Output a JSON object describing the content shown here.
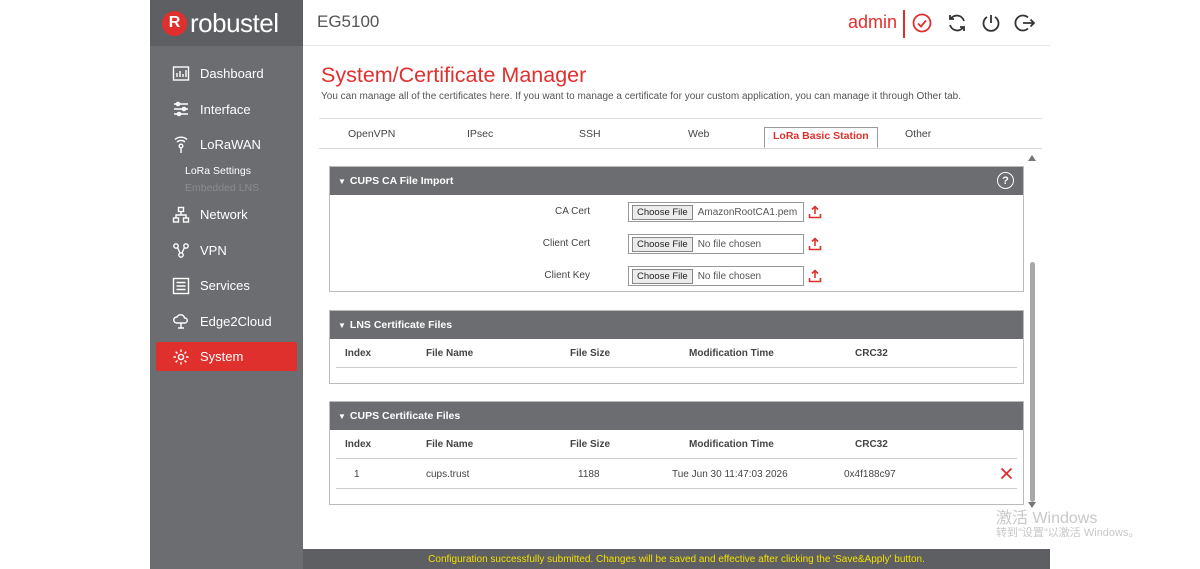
{
  "brand": {
    "logo_mark": "R",
    "name": "robustel"
  },
  "header": {
    "device": "EG5100",
    "user": "admin",
    "icons": [
      "check-circle-icon",
      "refresh-icon",
      "power-refresh-icon",
      "logout-icon"
    ]
  },
  "sidebar": {
    "items": [
      {
        "label": "Dashboard",
        "icon": "dashboard-icon"
      },
      {
        "label": "Interface",
        "icon": "sliders-icon"
      },
      {
        "label": "LoRaWAN",
        "icon": "signal-icon"
      },
      {
        "label": "Network",
        "icon": "network-icon"
      },
      {
        "label": "VPN",
        "icon": "vpn-icon"
      },
      {
        "label": "Services",
        "icon": "list-icon"
      },
      {
        "label": "Edge2Cloud",
        "icon": "cloud-icon"
      },
      {
        "label": "System",
        "icon": "gear-icon"
      }
    ],
    "lorawan_sub": [
      "LoRa Settings",
      "Embedded LNS"
    ],
    "active": "System"
  },
  "page": {
    "title": "System/Certificate Manager",
    "subtitle": "You can manage all of the certificates here. If you want to manage a certificate for your custom application, you can manage it through Other tab."
  },
  "tabs": [
    "OpenVPN",
    "IPsec",
    "SSH",
    "Web",
    "LoRa Basic Station",
    "Other"
  ],
  "active_tab": "LoRa Basic Station",
  "cups_ca": {
    "title": "CUPS CA File Import",
    "help": "?",
    "choose_label": "Choose File",
    "rows": [
      {
        "label": "CA Cert",
        "file": "AmazonRootCA1.pem"
      },
      {
        "label": "Client Cert",
        "file": "No file chosen"
      },
      {
        "label": "Client Key",
        "file": "No file chosen"
      }
    ]
  },
  "lns_files": {
    "title": "LNS Certificate Files",
    "columns": [
      "Index",
      "File Name",
      "File Size",
      "Modification Time",
      "CRC32"
    ],
    "rows": []
  },
  "cups_files": {
    "title": "CUPS Certificate Files",
    "columns": [
      "Index",
      "File Name",
      "File Size",
      "Modification Time",
      "CRC32"
    ],
    "rows": [
      {
        "index": "1",
        "name": "cups.trust",
        "size": "1188",
        "time": "Tue Jun 30 11:47:03 2026",
        "crc": "0x4f188c97"
      }
    ]
  },
  "footer": "Configuration successfully submitted. Changes will be saved and effective after clicking the 'Save&Apply' button.",
  "watermark": {
    "line1": "激活 Windows",
    "line2": "转到\"设置\"以激活 Windows。"
  },
  "colors": {
    "accent": "#e0302d",
    "sidebar": "#6b6d70",
    "footer_text": "#f2e000"
  }
}
